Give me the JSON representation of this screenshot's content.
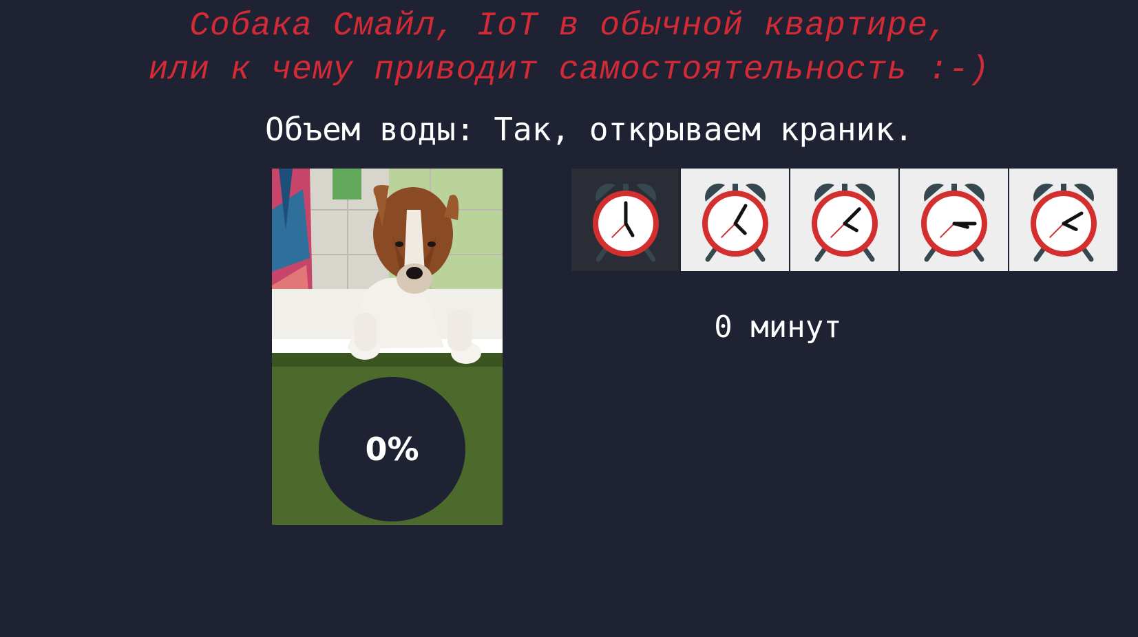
{
  "header": {
    "title_line_1": "Собака Смайл, IoT в обычной квартире,",
    "title_line_2": "или к чему приводит самостоятельность :-)",
    "title_color": "#d42a36"
  },
  "water": {
    "label": "Объем воды:",
    "status": "Так, открываем краник.",
    "percent_text": "0%",
    "fill_percent": 0
  },
  "timer": {
    "minutes_text": "0 минут",
    "selected_index": 0,
    "options": [
      {
        "icon": "alarm-clock-icon",
        "hour_angle": 150,
        "minute_angle": 0
      },
      {
        "icon": "alarm-clock-icon",
        "hour_angle": 135,
        "minute_angle": 30
      },
      {
        "icon": "alarm-clock-icon",
        "hour_angle": 120,
        "minute_angle": 45
      },
      {
        "icon": "alarm-clock-icon",
        "hour_angle": 105,
        "minute_angle": 90
      },
      {
        "icon": "alarm-clock-icon",
        "hour_angle": 115,
        "minute_angle": 60
      }
    ]
  },
  "colors": {
    "background": "#1e2233",
    "clock_ring": "#d32f2f",
    "clock_bell": "#37474f",
    "tile_bg": "#eeeeee",
    "tile_active_bg": "#2a2c36"
  }
}
